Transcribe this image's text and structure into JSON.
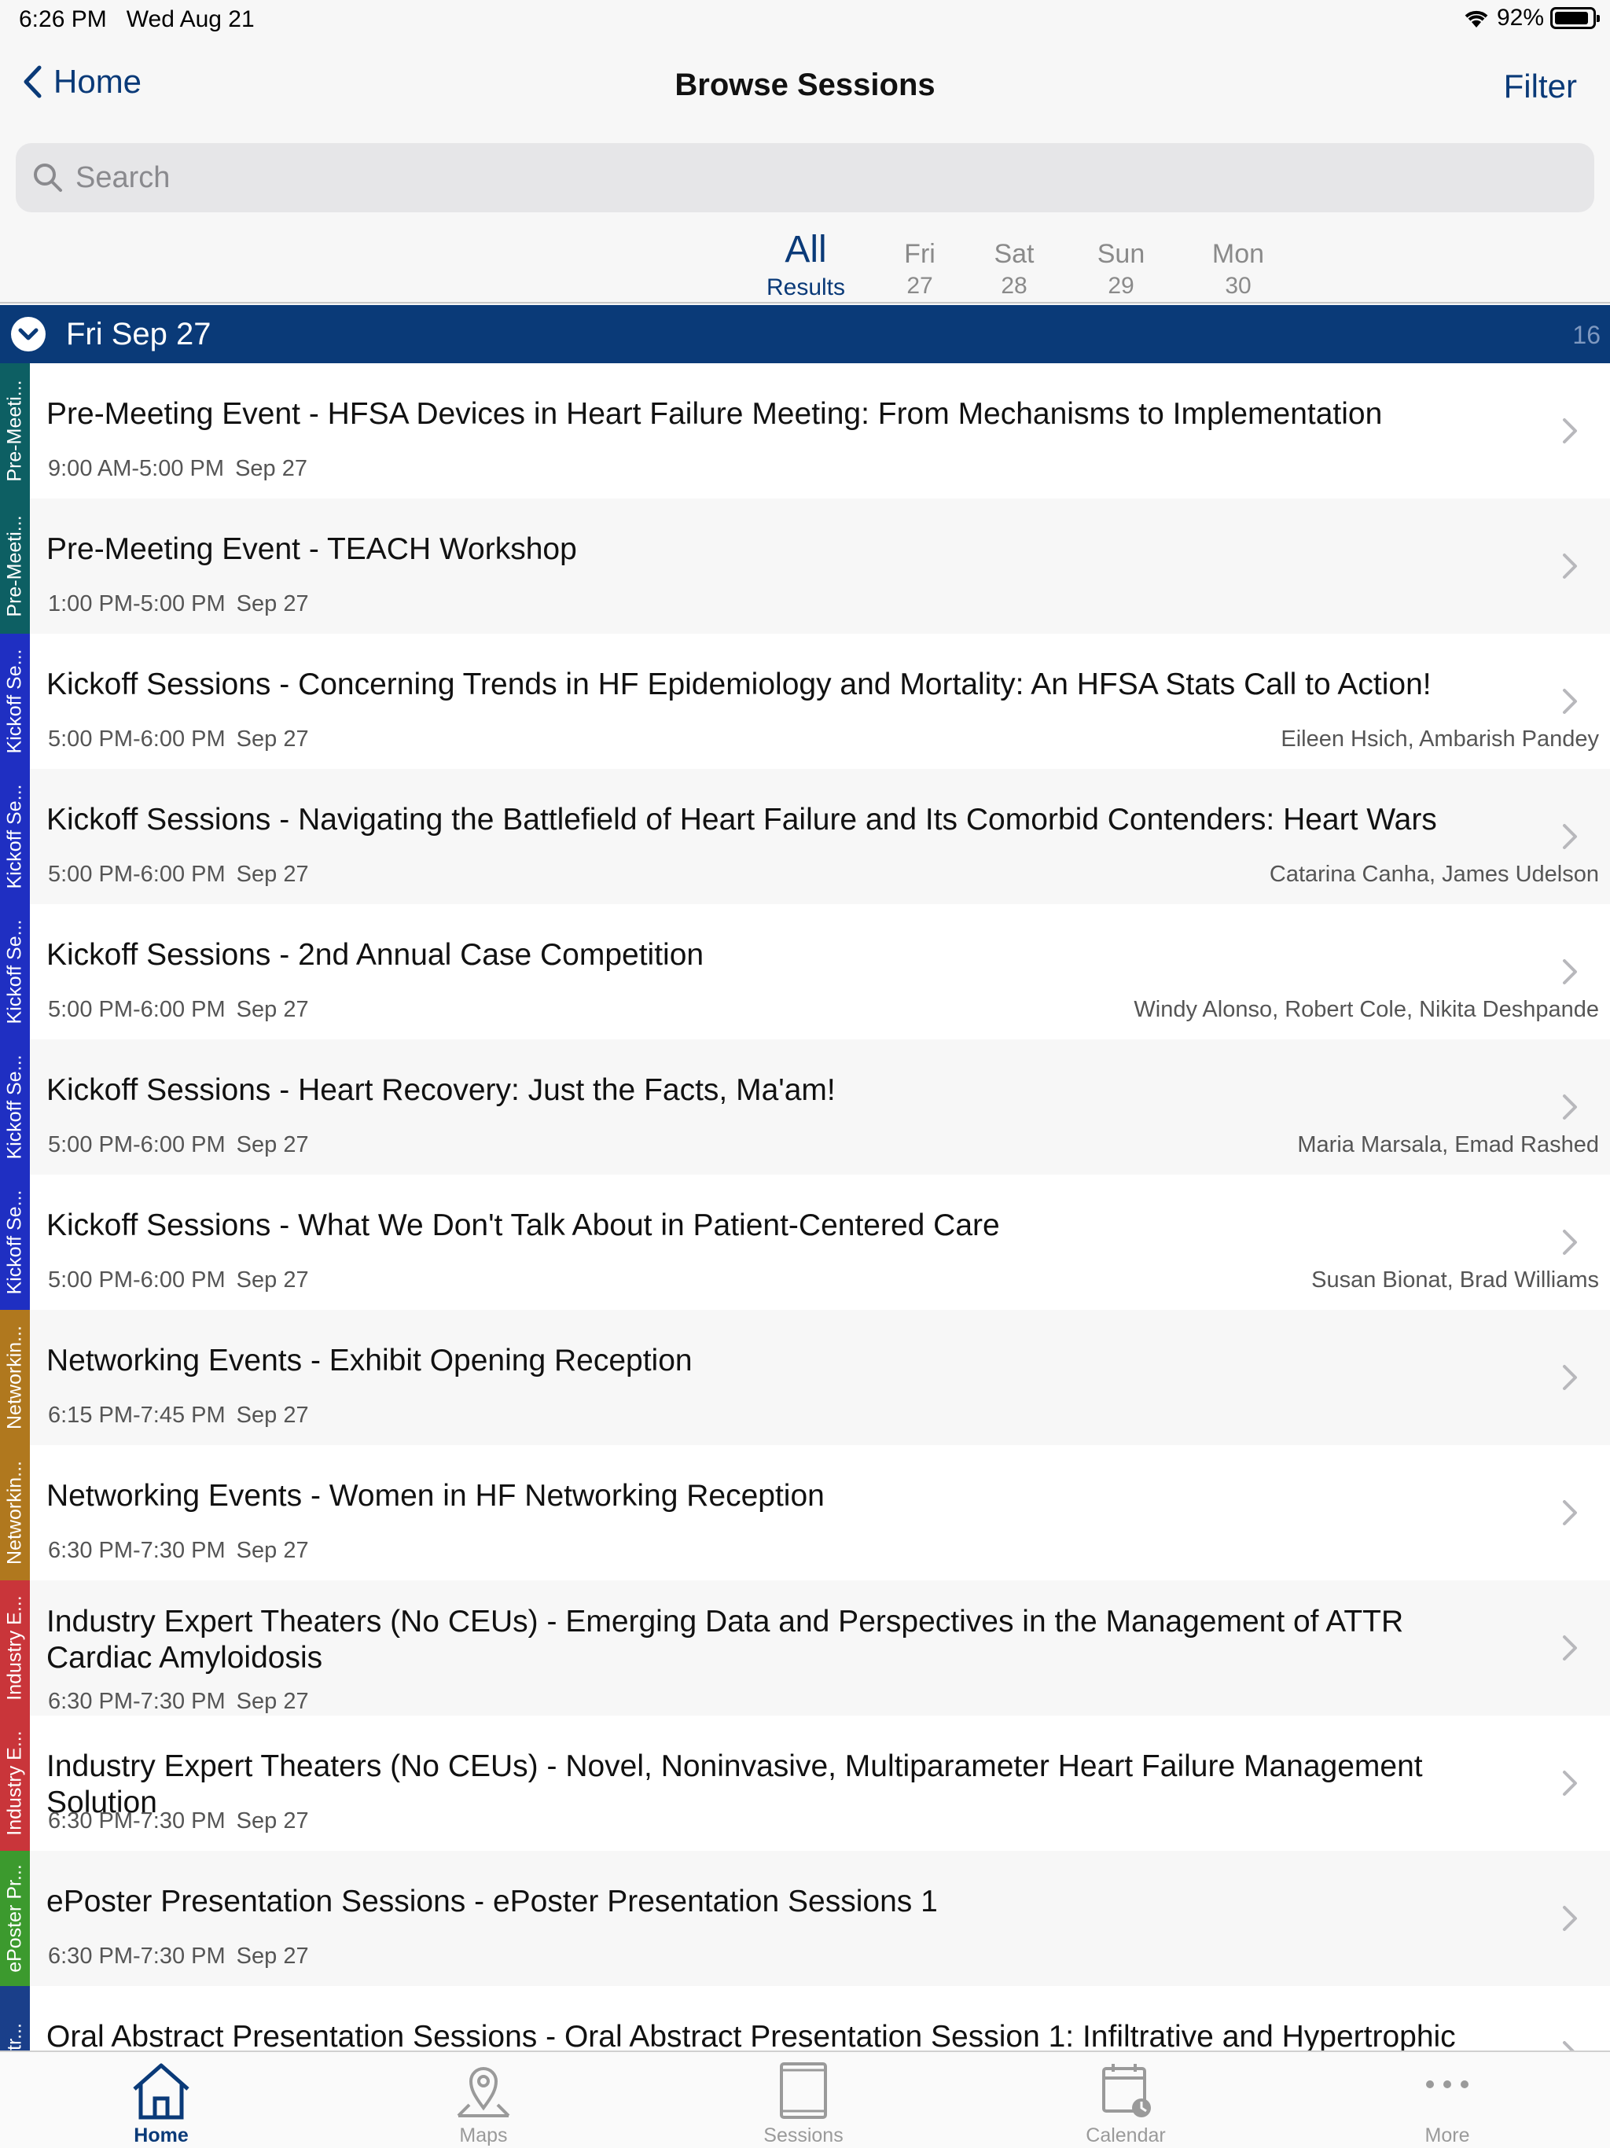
{
  "status_bar": {
    "time": "6:26 PM",
    "date": "Wed Aug 21",
    "battery": "92%",
    "battery_level": 0.92
  },
  "nav": {
    "back_label": "Home",
    "title": "Browse Sessions",
    "filter_label": "Filter"
  },
  "search": {
    "placeholder": "Search"
  },
  "day_tabs": [
    {
      "top": "All",
      "bottom": "Results",
      "active": true
    },
    {
      "top": "Fri",
      "bottom": "27"
    },
    {
      "top": "Sat",
      "bottom": "28"
    },
    {
      "top": "Sun",
      "bottom": "29"
    },
    {
      "top": "Mon",
      "bottom": "30"
    }
  ],
  "section": {
    "title": "Fri Sep 27",
    "count": "16"
  },
  "sessions": [
    {
      "track": "Pre-Meeti...",
      "track_color": "#0d5f63",
      "title": "Pre-Meeting Event - HFSA Devices in Heart Failure Meeting: From Mechanisms to Implementation",
      "time": "9:00 AM-5:00 PM",
      "date": "Sep 27",
      "speakers": ""
    },
    {
      "track": "Pre-Meeti...",
      "track_color": "#0d5f63",
      "title": "Pre-Meeting Event - TEACH Workshop",
      "time": "1:00 PM-5:00 PM",
      "date": "Sep 27",
      "speakers": ""
    },
    {
      "track": "Kickoff Se...",
      "track_color": "#1f2fc2",
      "title": "Kickoff Sessions - Concerning Trends in HF Epidemiology and Mortality: An HFSA Stats Call to Action!",
      "time": "5:00 PM-6:00 PM",
      "date": "Sep 27",
      "speakers": "Eileen Hsich, Ambarish Pandey"
    },
    {
      "track": "Kickoff Se...",
      "track_color": "#1f2fc2",
      "title": "Kickoff Sessions - Navigating the Battlefield of Heart Failure and Its Comorbid Contenders: Heart Wars",
      "time": "5:00 PM-6:00 PM",
      "date": "Sep 27",
      "speakers": "Catarina Canha, James Udelson"
    },
    {
      "track": "Kickoff Se...",
      "track_color": "#1f2fc2",
      "title": "Kickoff Sessions - 2nd Annual Case Competition",
      "time": "5:00 PM-6:00 PM",
      "date": "Sep 27",
      "speakers": "Windy Alonso, Robert Cole, Nikita Deshpande"
    },
    {
      "track": "Kickoff Se...",
      "track_color": "#1f2fc2",
      "title": "Kickoff Sessions - Heart Recovery: Just the Facts, Ma'am!",
      "time": "5:00 PM-6:00 PM",
      "date": "Sep 27",
      "speakers": "Maria Marsala, Emad Rashed"
    },
    {
      "track": "Kickoff Se...",
      "track_color": "#1f2fc2",
      "title": "Kickoff Sessions - What We Don't Talk About in Patient-Centered Care",
      "time": "5:00 PM-6:00 PM",
      "date": "Sep 27",
      "speakers": "Susan Bionat, Brad Williams"
    },
    {
      "track": "Networkin...",
      "track_color": "#b0781e",
      "title": "Networking Events - Exhibit Opening Reception",
      "time": "6:15 PM-7:45 PM",
      "date": "Sep 27",
      "speakers": ""
    },
    {
      "track": "Networkin...",
      "track_color": "#b0781e",
      "title": "Networking Events - Women in HF Networking Reception",
      "time": "6:30 PM-7:30 PM",
      "date": "Sep 27",
      "speakers": ""
    },
    {
      "track": "Industry E...",
      "track_color": "#c9353a",
      "title": "Industry Expert Theaters (No CEUs) - Emerging Data and Perspectives in the Management of ATTR Cardiac Amyloidosis",
      "time": "6:30 PM-7:30 PM",
      "date": "Sep 27",
      "speakers": "",
      "two_line": true
    },
    {
      "track": "Industry E...",
      "track_color": "#c9353a",
      "title": "Industry Expert Theaters (No CEUs) - Novel, Noninvasive, Multiparameter Heart Failure Management Solution",
      "time": "6:30 PM-7:30 PM",
      "date": "Sep 27",
      "speakers": ""
    },
    {
      "track": "ePoster Pr...",
      "track_color": "#3c9a2e",
      "title": "ePoster Presentation Sessions - ePoster Presentation Sessions 1",
      "time": "6:30 PM-7:30 PM",
      "date": "Sep 27",
      "speakers": ""
    },
    {
      "track": "Abstr...",
      "track_color": "#1a3f8a",
      "title": "Oral Abstract Presentation Sessions - Oral Abstract Presentation Session 1: Infiltrative and Hypertrophic Cardiomyopathies - Right in the Thick of It",
      "time": "",
      "date": "",
      "speakers": ""
    }
  ],
  "tab_bar": [
    {
      "label": "Home",
      "icon": "home-icon",
      "active": true
    },
    {
      "label": "Maps",
      "icon": "map-pin-icon"
    },
    {
      "label": "Sessions",
      "icon": "book-icon"
    },
    {
      "label": "Calendar",
      "icon": "calendar-icon"
    },
    {
      "label": "More",
      "icon": "more-dots-icon"
    }
  ],
  "colors": {
    "accent": "#0a3a78",
    "section_bg": "#0a3a78"
  }
}
